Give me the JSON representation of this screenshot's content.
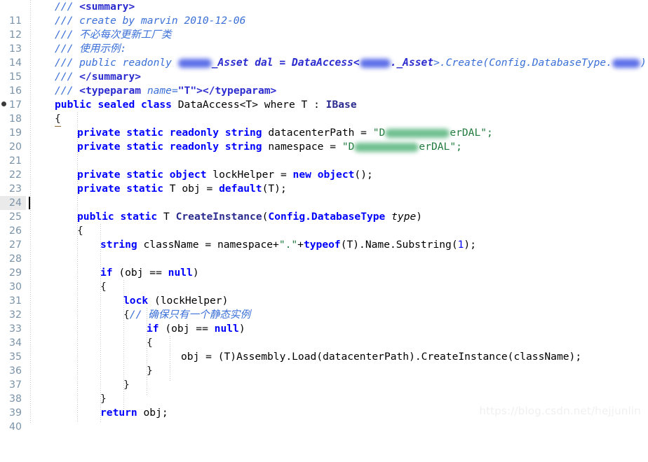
{
  "editor": {
    "language": "csharp",
    "first_line_number": 11,
    "last_line_number": 40,
    "current_line": 25,
    "bookmark_line": 18,
    "background_color": "#ffffff",
    "line_number_color": "#7b93a8",
    "current_line_highlight_color": "#eaeaea",
    "caret_color": "#000000"
  },
  "colors": {
    "keyword": "#0000ff",
    "class_name": "#2b2b8f",
    "string": "#1f7a3d",
    "comment": "#3a6fd8",
    "number": "#0000ff",
    "plain_text": "#000000",
    "redaction_blue": "#5d6fe8",
    "redaction_green": "#6fbf8f"
  },
  "watermark": "https://blog.csdn.net/hejjunlin",
  "lines": [
    {
      "n": "11",
      "text": "    /// <summary>"
    },
    {
      "n": "12",
      "text": "    /// create by marvin 2010-12-06"
    },
    {
      "n": "13",
      "text": "    /// 不必每次更新工厂类"
    },
    {
      "n": "14",
      "text": "    /// 使用示例:"
    },
    {
      "n": "15",
      "text": "    /// public readonly ██████_Asset dal = DataAccess<██████._Asset>.Create(Config.DatabaseType.████)"
    },
    {
      "n": "16",
      "text": "    /// </summary>"
    },
    {
      "n": "17",
      "text": "    /// <typeparam name=\"T\"></typeparam>"
    },
    {
      "n": "18",
      "text": "    public sealed class DataAccess<T> where T : IBase"
    },
    {
      "n": "19",
      "text": "    {"
    },
    {
      "n": "20",
      "text": "        private static readonly string datacenterPath = \"D███████████erDAL\";"
    },
    {
      "n": "21",
      "text": "        private static readonly string namespace = \"D███████████erDAL\";"
    },
    {
      "n": "22",
      "text": ""
    },
    {
      "n": "23",
      "text": "        private static object lockHelper = new object();"
    },
    {
      "n": "24",
      "text": "        private static T obj = default(T);"
    },
    {
      "n": "25",
      "text": ""
    },
    {
      "n": "26",
      "text": "        public static T CreateInstance(Config.DatabaseType type)"
    },
    {
      "n": "27",
      "text": "        {"
    },
    {
      "n": "28",
      "text": "            string className = namespace+\".\"+typeof(T).Name.Substring(1);"
    },
    {
      "n": "29",
      "text": ""
    },
    {
      "n": "30",
      "text": "            if (obj == null)"
    },
    {
      "n": "31",
      "text": "            {"
    },
    {
      "n": "32",
      "text": "                lock (lockHelper)"
    },
    {
      "n": "33",
      "text": "                {// 确保只有一个静态实例"
    },
    {
      "n": "34",
      "text": "                    if (obj == null)"
    },
    {
      "n": "35",
      "text": "                    {"
    },
    {
      "n": "36",
      "text": "                        obj = (T)Assembly.Load(datacenterPath).CreateInstance(className);"
    },
    {
      "n": "37",
      "text": "                    }"
    },
    {
      "n": "38",
      "text": "                }"
    },
    {
      "n": "39",
      "text": "            }"
    },
    {
      "n": "40",
      "text": "            return obj;"
    }
  ],
  "tokens": {
    "l11": [
      "/// ",
      "<summary>"
    ],
    "l12": [
      "/// create by marvin 2010-12-06"
    ],
    "l13": [
      "/// 不必每次更新工厂类"
    ],
    "l14": [
      "/// 使用示例:"
    ],
    "l15_a": "/// public readonly ",
    "l15_b": "_Asset dal = DataAccess<",
    "l15_c": "._Asset",
    "l15_d": ">.Create(Config.DatabaseType.",
    "l15_e": ")",
    "l16": [
      "/// ",
      "</summary>"
    ],
    "l17_a": "/// ",
    "l17_b": "<typeparam ",
    "l17_c": "name=",
    "l17_d": "\"T\"",
    "l17_e": "></typeparam>",
    "l18_kw1": "public",
    "l18_kw2": "sealed",
    "l18_kw3": "class",
    "l18_name": "DataAccess<T>",
    "l18_where": "where T : ",
    "l18_ibase": "IBase",
    "l19": "{",
    "l20_kw": "private static readonly string",
    "l20_var": " datacenterPath = ",
    "l20_s1": "\"D",
    "l20_s2": "erDAL\";",
    "l21_kw": "private static readonly string",
    "l21_var": " namespace = ",
    "l21_s1": "\"D",
    "l21_s2": "erDAL\";",
    "l23_kw": "private static object",
    "l23_mid": " lockHelper = ",
    "l23_new": "new",
    "l23_obj": "object",
    "l23_tail": "();",
    "l24_kw": "private static",
    "l24_t": " T obj = ",
    "l24_def": "default",
    "l24_tail": "(T);",
    "l26_kw": "public static",
    "l26_t": " T ",
    "l26_fn": "CreateInstance",
    "l26_p1": "(",
    "l26_p2": "Config.DatabaseType",
    "l26_p3": " type",
    "l26_p4": ")",
    "l27": "{",
    "l28_kw": "string",
    "l28_a": " className = namespace+",
    "l28_s": "\".\"",
    "l28_b": "+",
    "l28_typeof": "typeof",
    "l28_c": "(T).Name.Substring(",
    "l28_n": "1",
    "l28_d": ");",
    "l30_if": "if",
    "l30_a": " (obj == ",
    "l30_null": "null",
    "l30_b": ")",
    "l31": "{",
    "l32_lock": "lock",
    "l32_a": " (lockHelper)",
    "l33_brace": "{",
    "l33_cmt": "// 确保只有一个静态实例",
    "l34_if": "if",
    "l34_a": " (obj == ",
    "l34_null": "null",
    "l34_b": ")",
    "l35": "{",
    "l36": "obj = (T)Assembly.Load(datacenterPath).CreateInstance(className);",
    "l37": "}",
    "l38": "}",
    "l39": "}",
    "l40_ret": "return",
    "l40_a": " obj;"
  }
}
